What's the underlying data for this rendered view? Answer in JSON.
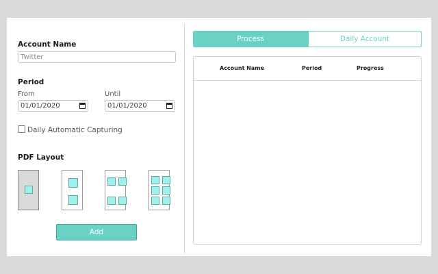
{
  "form": {
    "account_name_label": "Account Name",
    "account_name_value": "Twitter",
    "period_label": "Period",
    "from_label": "From",
    "until_label": "Until",
    "from_date": "01/01/2020",
    "until_date": "01/01/2020",
    "daily_capture_label": "Daily Automatic Capturing",
    "daily_capture_checked": false,
    "pdf_layout_label": "PDF Layout",
    "pdf_layouts": [
      {
        "name": "1 per page",
        "selected": true
      },
      {
        "name": "2 per page",
        "selected": false
      },
      {
        "name": "4 per page",
        "selected": false
      },
      {
        "name": "6 per page",
        "selected": false
      }
    ],
    "add_label": "Add"
  },
  "tabs": [
    {
      "label": "Process",
      "active": true
    },
    {
      "label": "Daily Account",
      "active": false
    }
  ],
  "table": {
    "columns": [
      "Account Name",
      "Period",
      "Progress"
    ],
    "rows": []
  },
  "colors": {
    "accent": "#69d2c4",
    "layout_square": "#9ff0ec"
  }
}
